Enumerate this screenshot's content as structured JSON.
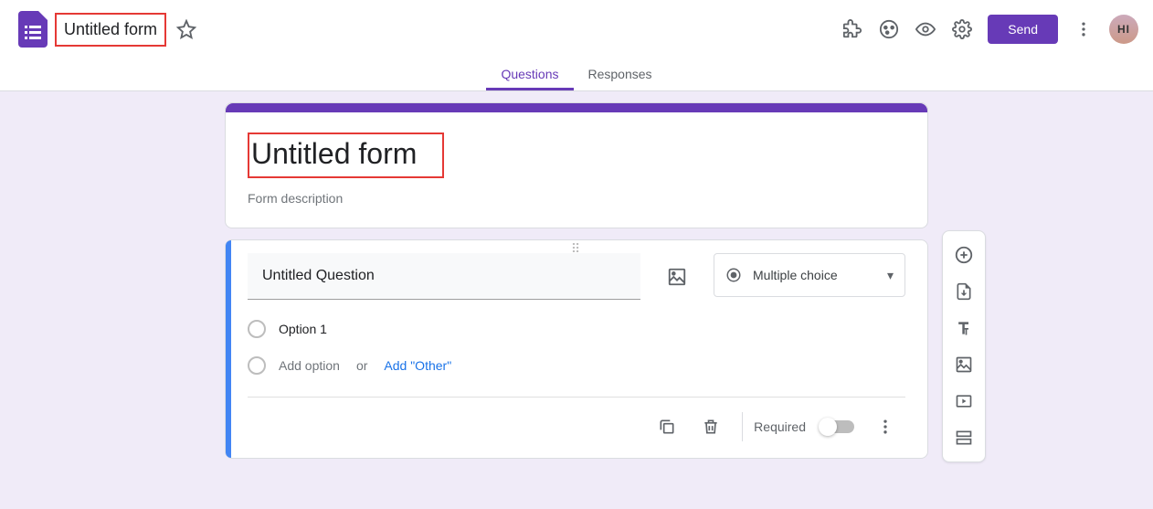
{
  "header": {
    "doc_title": "Untitled form",
    "send_label": "Send",
    "avatar_text": "HI"
  },
  "tabs": {
    "questions": "Questions",
    "responses": "Responses"
  },
  "form": {
    "title": "Untitled form",
    "description_placeholder": "Form description"
  },
  "question": {
    "title": "Untitled Question",
    "type_label": "Multiple choice",
    "option1": "Option 1",
    "add_option": "Add option",
    "or": "or",
    "add_other": "Add \"Other\"",
    "required_label": "Required"
  },
  "colors": {
    "theme": "#673ab7",
    "highlight": "#e53935",
    "canvas": "#f0ebf8",
    "active_bar": "#4285f4"
  }
}
